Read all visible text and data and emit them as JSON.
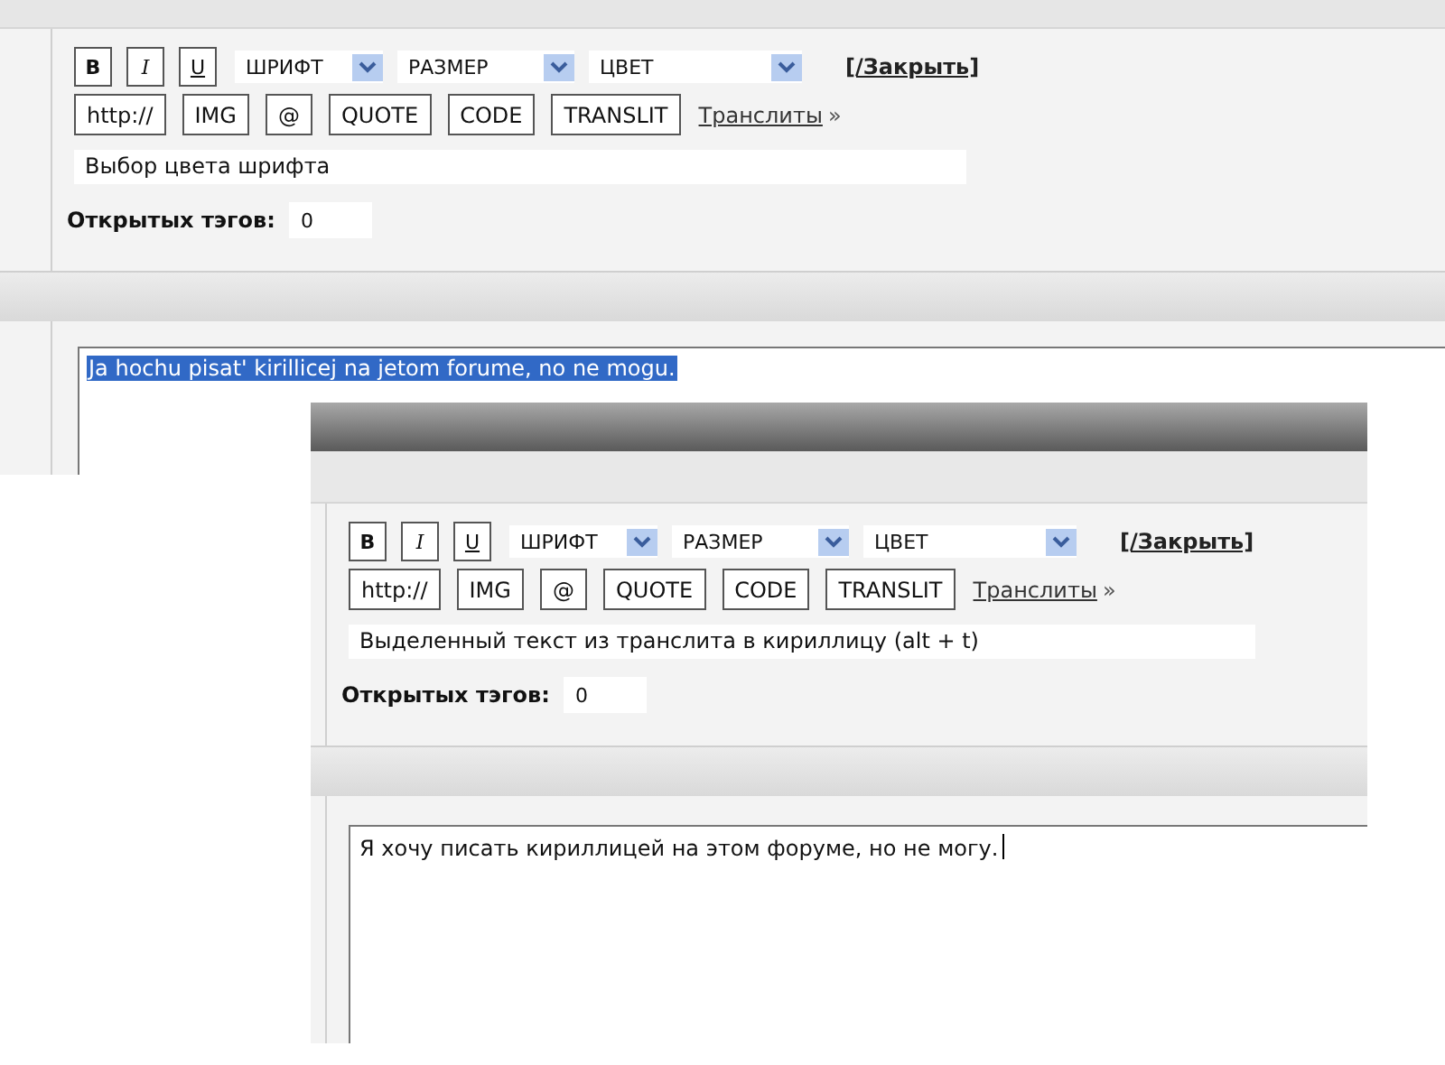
{
  "panels": [
    {
      "format_buttons": [
        {
          "label": "B",
          "kind": "bold"
        },
        {
          "label": "I",
          "kind": "italic"
        },
        {
          "label": "U",
          "kind": "underline"
        }
      ],
      "dropdowns": [
        {
          "label": "ШРИФТ"
        },
        {
          "label": "РАЗМЕР"
        },
        {
          "label": "ЦВЕТ"
        }
      ],
      "close_link": "[/Закрыть]",
      "tag_buttons": [
        "http://",
        "IMG",
        "@",
        "QUOTE",
        "CODE",
        "TRANSLIT"
      ],
      "translit_link": "Транслиты",
      "translit_arrow": "»",
      "hint": "Выбор цвета шрифта",
      "open_tags_label": "Открытых тэгов:",
      "open_tags_value": "0",
      "message": {
        "text": "Ja hochu pisat' kirillicej na jetom forume, no ne mogu.",
        "selected": true,
        "caret": false
      }
    },
    {
      "format_buttons": [
        {
          "label": "B",
          "kind": "bold"
        },
        {
          "label": "I",
          "kind": "italic"
        },
        {
          "label": "U",
          "kind": "underline"
        }
      ],
      "dropdowns": [
        {
          "label": "ШРИФТ"
        },
        {
          "label": "РАЗМЕР"
        },
        {
          "label": "ЦВЕТ"
        }
      ],
      "close_link": "[/Закрыть]",
      "tag_buttons": [
        "http://",
        "IMG",
        "@",
        "QUOTE",
        "CODE",
        "TRANSLIT"
      ],
      "translit_link": "Транслиты",
      "translit_arrow": "»",
      "hint": "Выделенный текст из транслита в кириллицу (alt + t)",
      "open_tags_label": "Открытых тэгов:",
      "open_tags_value": "0",
      "message": {
        "text": "Я хочу писать кириллицей на этом форуме, но не могу.",
        "selected": false,
        "caret": true
      }
    }
  ]
}
